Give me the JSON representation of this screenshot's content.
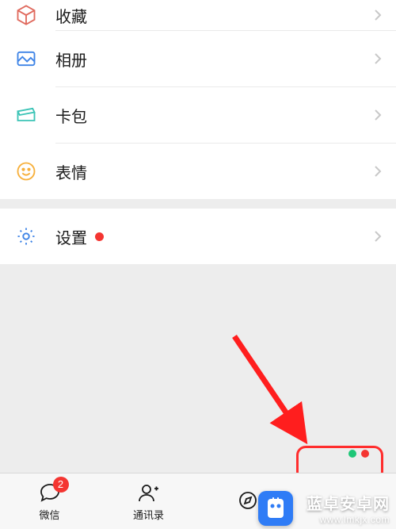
{
  "colors": {
    "accent_red": "#f43531",
    "accent_green": "#1ec777",
    "icon_blue": "#3d83e6",
    "icon_green": "#3cc4b6",
    "icon_yellow": "#f7b03c",
    "chevron": "#c8c8c8",
    "bg": "#ededed"
  },
  "list": {
    "items": [
      {
        "key": "favorites",
        "label": "收藏",
        "icon": "cube-icon"
      },
      {
        "key": "album",
        "label": "相册",
        "icon": "photo-icon"
      },
      {
        "key": "cards",
        "label": "卡包",
        "icon": "wallet-icon"
      },
      {
        "key": "stickers",
        "label": "表情",
        "icon": "smile-icon"
      }
    ],
    "settings": {
      "label": "设置",
      "icon": "gear-icon",
      "has_dot": true
    }
  },
  "tabbar": {
    "items": [
      {
        "key": "chats",
        "label": "微信",
        "icon": "chat-icon",
        "badge": "2"
      },
      {
        "key": "contacts",
        "label": "通讯录",
        "icon": "contacts-icon",
        "badge": null
      },
      {
        "key": "discover",
        "label": "",
        "icon": "discover-icon",
        "badge": null
      },
      {
        "key": "me",
        "label": "",
        "icon": "me-icon",
        "badge": null,
        "highlighted": true
      }
    ]
  },
  "watermark": {
    "title": "蓝卓安卓网",
    "url": "www.lmkjx.com"
  }
}
